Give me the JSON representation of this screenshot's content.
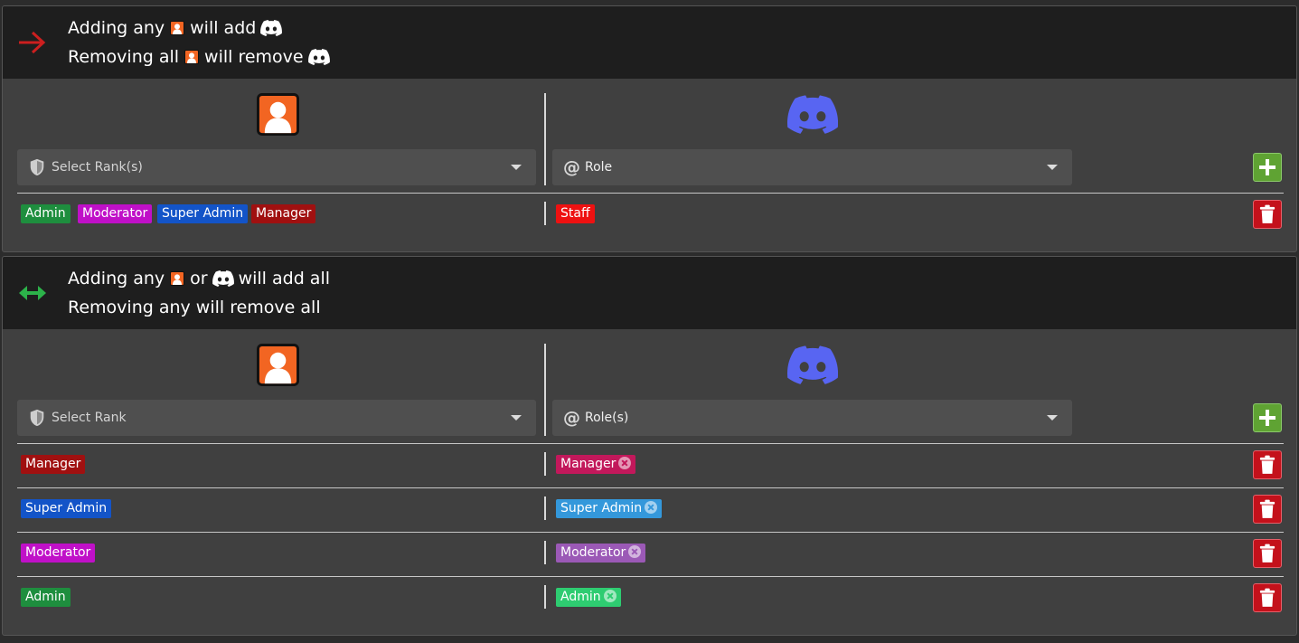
{
  "sections": [
    {
      "header": {
        "mode": "one-way",
        "arrow_color": "#cc1f1f",
        "line1": {
          "before": "Adding any",
          "middle": "will add"
        },
        "line2": {
          "before": "Removing all",
          "middle": "will remove"
        }
      },
      "rank_select_placeholder": "Select Rank(s)",
      "role_select_placeholder": "Role",
      "rows": [
        {
          "ranks": [
            {
              "label": "Admin",
              "color": "#1e8e3e"
            },
            {
              "label": "Moderator",
              "color": "#c010c8"
            },
            {
              "label": "Super Admin",
              "color": "#1354c8"
            },
            {
              "label": "Manager",
              "color": "#a01010"
            }
          ],
          "roles": [
            {
              "label": "Staff",
              "color": "#ee1111",
              "removable": false
            }
          ]
        }
      ]
    },
    {
      "header": {
        "mode": "two-way",
        "arrow_color": "#2cb34a",
        "line1": {
          "before": "Adding any",
          "middle": "or",
          "after": "will add all"
        },
        "line2": {
          "text": "Removing any will remove all"
        }
      },
      "rank_select_placeholder": "Select Rank",
      "role_select_placeholder": "Role(s)",
      "rows": [
        {
          "rank": {
            "label": "Manager",
            "color": "#a01010"
          },
          "role": {
            "label": "Manager",
            "color": "#c2185b",
            "removable": true
          }
        },
        {
          "rank": {
            "label": "Super Admin",
            "color": "#1354c8"
          },
          "role": {
            "label": "Super Admin",
            "color": "#3498db",
            "removable": true
          }
        },
        {
          "rank": {
            "label": "Moderator",
            "color": "#c010c8"
          },
          "role": {
            "label": "Moderator",
            "color": "#9b59b6",
            "removable": true
          }
        },
        {
          "rank": {
            "label": "Admin",
            "color": "#1e8e3e"
          },
          "role": {
            "label": "Admin",
            "color": "#2ecc71",
            "removable": true
          }
        }
      ]
    }
  ],
  "icons": {
    "rank": "rank-person-icon",
    "discord": "discord-icon",
    "shield": "shield-icon",
    "at": "at-icon",
    "add": "plus-icon",
    "delete": "trash-icon",
    "remove_tag": "close-circle-icon"
  },
  "colors": {
    "discord": "#5865f2",
    "rank_orange": "#f26522",
    "add_button": "#5fa333",
    "delete_button": "#c4111b"
  }
}
